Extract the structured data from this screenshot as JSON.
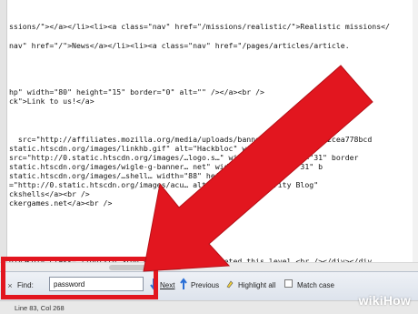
{
  "code_lines": [
    "ssions/\"></a></li><li><a class=\"nav\" href=\"/missions/realistic/\">Realistic missions</",
    "",
    "nav\" href=\"/\">News</a></li><li><a class=\"nav\" href=\"/pages/articles/article.",
    "",
    "",
    "",
    "hp\" width=\"80\" height=\"15\" border=\"0\" alt=\"\" /></a><br />",
    "ck\">Link to us!</a>",
    "",
    "",
    "  src=\"http://affiliates.mozilla.org/media/uploads/banners/ac502446d8392cea778bcd",
    "static.htscdn.org/images/linkhb.gif\" alt=\"Hackbloc\" width=\"88\" h",
    "src=\"http://0.static.htscdn.org/images/…logo.s…\" width=\"88\" height=\"31\" border",
    "static.htscdn.org/images/wigle-g-banner… net\" width=\"88\" height=\"31\" b",
    "static.htscdn.org/images/…shell… width=\"88\" height=\"31\" border",
    "=\"http://0.static.htscdn.org/images/acu… alt=\"Acunetix Security Blog\"",
    "ckshells</a><br />",
    "ckergames.net</a><br />",
    "",
    "",
    "",
    "",
    "",
    "",
    "div><div class=\"light-td\">You have already completed this level.<br /></div></div"
  ],
  "find_bar": {
    "close": "×",
    "find_label": "Find:",
    "find_value": "password",
    "clear": "×",
    "next_label": "Next",
    "previous_label": "Previous",
    "highlight_label": "Highlight all",
    "match_case_label": "Match case",
    "match_case_checked": false
  },
  "status_bar": {
    "position": "Line 83, Col 268"
  },
  "watermark": {
    "wiki": "wiki",
    "how": "How"
  },
  "colors": {
    "annotation_red": "#e2161f",
    "find_bar_bg": "#dde3ec",
    "arrow_blue": "#2a6fd6"
  }
}
